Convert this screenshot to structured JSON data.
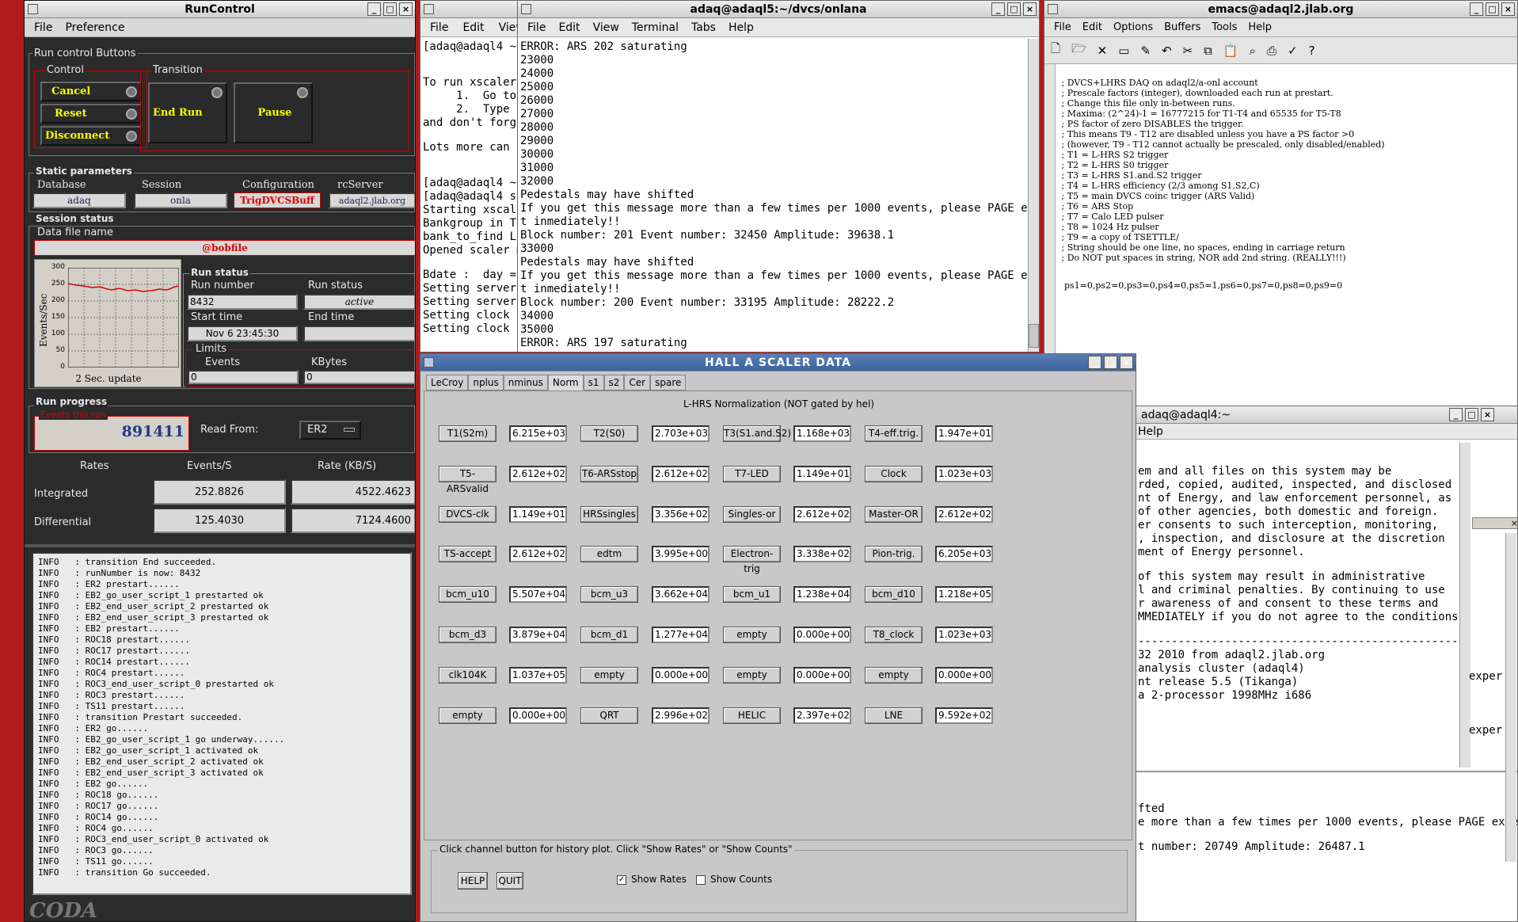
{
  "runcontrol": {
    "title": "RunControl",
    "menu": [
      "File",
      "Preference"
    ],
    "run_control_buttons_label": "Run control Buttons",
    "control_label": "Control",
    "transition_label": "Transition",
    "cancel": "Cancel",
    "reset": "Reset",
    "disconnect": "Disconnect",
    "end_run": "End Run",
    "pause": "Pause",
    "static_label": "Static parameters",
    "db_label": "Database",
    "db_value": "adaq",
    "session_label": "Session",
    "session_value": "onla",
    "config_label": "Configuration",
    "config_value": "TrigDVCSBuff",
    "rcserver_label": "rcServer",
    "rcserver_value": "adaql2.jlab.org",
    "session_status_label": "Session status",
    "data_file_label": "Data file name",
    "data_file_value": "@bobfile",
    "plot_ylabel": "Events/Sec",
    "plot_yticks": [
      "300",
      "250",
      "200",
      "150",
      "100",
      "50",
      "0"
    ],
    "plot_caption": "2 Sec. update",
    "run_status_label": "Run status",
    "run_number_label": "Run number",
    "run_number_value": "8432",
    "run_status_sub_label": "Run status",
    "run_status_value": "active",
    "start_time_label": "Start time",
    "start_time_value": "Nov 6 23:45:30",
    "end_time_label": "End time",
    "end_time_value": "",
    "limits_label": "Limits",
    "events_label": "Events",
    "events_value": "0",
    "kbytes_label": "KBytes",
    "kbytes_value": "0",
    "run_progress_label": "Run progress",
    "events_this_run_label": "Events this run",
    "events_this_run_value": "891411",
    "read_from_label": "Read From:",
    "read_from_value": "ER2",
    "rates_label": "Rates",
    "events_s_label": "Events/S",
    "rate_kbs_label": "Rate (KB/S)",
    "integrated_label": "Integrated",
    "integrated_events": "252.8826",
    "integrated_rate": "4522.4623",
    "differential_label": "Differential",
    "differential_events": "125.4030",
    "differential_rate": "7124.4600",
    "log_lines": [
      "INFO   : transition End succeeded.",
      "INFO   : runNumber is now: 8432",
      "INFO   : ER2 prestart......",
      "INFO   : EB2_go_user_script_1 prestarted ok",
      "INFO   : EB2_end_user_script_2 prestarted ok",
      "INFO   : EB2_end_user_script_3 prestarted ok",
      "INFO   : EB2 prestart......",
      "INFO   : ROC18 prestart......",
      "INFO   : ROC17 prestart......",
      "INFO   : ROC14 prestart......",
      "INFO   : ROC4 prestart......",
      "INFO   : ROC3_end_user_script_0 prestarted ok",
      "INFO   : ROC3 prestart......",
      "INFO   : TS11 prestart......",
      "INFO   : transition Prestart succeeded.",
      "INFO   : ER2 go......",
      "INFO   : EB2_go_user_script_1 go underway......",
      "INFO   : EB2_go_user_script_1 activated ok",
      "INFO   : EB2_end_user_script_2 activated ok",
      "INFO   : EB2_end_user_script_3 activated ok",
      "INFO   : EB2 go......",
      "INFO   : ROC18 go......",
      "INFO   : ROC17 go......",
      "INFO   : ROC14 go......",
      "INFO   : ROC4 go......",
      "INFO   : ROC3_end_user_script_0 activated ok",
      "INFO   : ROC3 go......",
      "INFO   : TS11 go......",
      "INFO   : transition Go succeeded."
    ],
    "logo": "CODA"
  },
  "term1": {
    "lines": [
      "[adaq@adaql4 ~]",
      "",
      "",
      "To run xscaler",
      "     1.  Go to",
      "     2.  Type '",
      "and don't forge",
      "",
      "Lots more can b",
      "",
      "",
      "[adaq@adaql4 ~]",
      "[adaq@adaql4 sc",
      "Starting xscale",
      "Bankgroup in TH",
      "bank_to_find Le",
      "Opened scaler m",
      "",
      "Bdate :  day =",
      "Setting server",
      "Setting server",
      "Setting clock l",
      "Setting clock r"
    ]
  },
  "term2": {
    "title": "adaq@adaql5:~/dvcs/onlana",
    "menu": [
      "File",
      "Edit",
      "View",
      "Terminal",
      "Tabs",
      "Help"
    ],
    "lines": [
      "ERROR: ARS 202 saturating",
      "23000",
      "24000",
      "25000",
      "26000",
      "27000",
      "28000",
      "29000",
      "30000",
      "31000",
      "32000",
      "Pedestals may have shifted",
      "If you get this message more than a few times per 1000 events, please PAGE exper",
      "t inmediately!!",
      "Block number: 201 Event number: 32450 Amplitude: 39638.1",
      "33000",
      "Pedestals may have shifted",
      "If you get this message more than a few times per 1000 events, please PAGE exper",
      "t inmediately!!",
      "Block number: 200 Event number: 33195 Amplitude: 28222.2",
      "34000",
      "35000",
      "ERROR: ARS 197 saturating"
    ]
  },
  "emacs": {
    "title": "emacs@adaql2.jlab.org",
    "menu": [
      "File",
      "Edit",
      "Options",
      "Buffers",
      "Tools",
      "Help"
    ],
    "lines": [
      " ; DVCS+LHRS DAQ on adaql2/a-onl account",
      " ; Prescale factors (integer), downloaded each run at prestart.",
      " ; Change this file only in-between runs.",
      " ; Maxima: (2^24)-1 = 16777215 for T1-T4 and 65535 for T5-T8",
      " ; PS factor of zero DISABLES the trigger.",
      " ; This means T9 - T12 are disabled unless you have a PS factor >0",
      " ; (however, T9 - T12 cannot actually be prescaled, only disabled/enabled)",
      " ; T1 = L-HRS S2 trigger",
      " ; T2 = L-HRS S0 trigger",
      " ; T3 = L-HRS S1.and.S2 trigger",
      " ; T4 = L-HRS efficiency (2/3 among S1,S2,C)",
      " ; T5 = main DVCS coinc trigger (ARS Valid)",
      " ; T6 = ARS Stop",
      " ; T7 = Calo LED pulser",
      " ; T8 = 1024 Hz pulser",
      " ; T9 = a copy of TSETTLE/",
      " ; String should be one line, no spaces, ending in carriage return",
      " ; Do NOT put spaces in string, NOR add 2nd string. (REALLY!!!)",
      "",
      "",
      "  ps1=0,ps2=0,ps3=0,ps4=0,ps5=1,ps6=0,ps7=0,ps8=0,ps9=0"
    ]
  },
  "term4": {
    "title": "adaq@adaql4:~",
    "menu": [
      "Help"
    ],
    "lines": [
      "",
      "",
      "em and all files on this system may be",
      "rded, copied, audited, inspected, and disclosed",
      "nt of Energy, and law enforcement personnel, as",
      "of other agencies, both domestic and foreign.",
      "er consents to such interception, monitoring,",
      ", inspection, and disclosure at the discretion",
      "ment of Energy personnel.",
      "",
      "of this system may result in administrative",
      "l and criminal penalties. By continuing to use",
      "r awareness of and consent to these terms and",
      "MMEDIATELY if you do not agree to the conditions",
      "",
      "------------------------------------------------",
      "32 2010 from adaql2.jlab.org",
      "analysis cluster (adaql4)",
      "nt release 5.5 (Tikanga)",
      "a 2-processor 1998MHz i686"
    ],
    "bottom_lines": [
      "fted",
      "e more than a few times per 1000 events, please PAGE exper",
      "",
      "t number: 20749 Amplitude: 26487.1"
    ],
    "right_frag": [
      "exper",
      "exper"
    ]
  },
  "scaler": {
    "title": "HALL  A  SCALER  DATA",
    "tabs": [
      "LeCroy",
      "nplus",
      "nminus",
      "Norm",
      "s1",
      "s2",
      "Cer",
      "spare"
    ],
    "active_tab": "Norm",
    "subtitle": "L-HRS Normalization (NOT gated by hel)",
    "rows": [
      [
        [
          "T1(S2m)",
          "6.215e+03 Hz"
        ],
        [
          "T2(S0)",
          "2.703e+03 Hz"
        ],
        [
          "T3(S1.and.S2)",
          "1.168e+03 Hz"
        ],
        [
          "T4-eff.trig.",
          "1.947e+01 Hz"
        ]
      ],
      [
        [
          "T5-ARSvalid",
          "2.612e+02 Hz"
        ],
        [
          "T6-ARSstop",
          "2.612e+02 Hz"
        ],
        [
          "T7-LED",
          "1.149e+01 Hz"
        ],
        [
          "Clock",
          "1.023e+03 Hz"
        ]
      ],
      [
        [
          "DVCS-clk",
          "1.149e+01 Hz"
        ],
        [
          "HRSsingles",
          "3.356e+02 Hz"
        ],
        [
          "Singles-or",
          "2.612e+02 Hz"
        ],
        [
          "Master-OR",
          "2.612e+02 Hz"
        ]
      ],
      [
        [
          "TS-accept",
          "2.612e+02 Hz"
        ],
        [
          "edtm",
          "3.995e+00 Hz"
        ],
        [
          "Electron-trig",
          "3.338e+02 Hz"
        ],
        [
          "Pion-trig.",
          "6.205e+03 Hz"
        ]
      ],
      [
        [
          "bcm_u10",
          "5.507e+04 Hz"
        ],
        [
          "bcm_u3",
          "3.662e+04 Hz"
        ],
        [
          "bcm_u1",
          "1.238e+04 Hz"
        ],
        [
          "bcm_d10",
          "1.218e+05 Hz"
        ]
      ],
      [
        [
          "bcm_d3",
          "3.879e+04 Hz"
        ],
        [
          "bcm_d1",
          "1.277e+04 Hz"
        ],
        [
          "empty",
          "0.000e+00 Hz"
        ],
        [
          "T8_clock",
          "1.023e+03 Hz"
        ]
      ],
      [
        [
          "clk104K",
          "1.037e+05 Hz"
        ],
        [
          "empty",
          "0.000e+00 Hz"
        ],
        [
          "empty",
          "0.000e+00 Hz"
        ],
        [
          "empty",
          "0.000e+00 Hz"
        ]
      ],
      [
        [
          "empty",
          "0.000e+00 Hz"
        ],
        [
          "QRT",
          "2.996e+02 Hz"
        ],
        [
          "HELIC",
          "2.397e+02 Hz"
        ],
        [
          "LNE",
          "9.592e+02 Hz"
        ]
      ]
    ],
    "footer_text": "Click channel button for history plot.  Click \"Show Rates\" or \"Show Counts\"",
    "help": "HELP",
    "quit": "QUIT",
    "show_rates": "Show Rates",
    "show_rates_checked": true,
    "show_counts": "Show Counts",
    "show_counts_checked": false
  }
}
